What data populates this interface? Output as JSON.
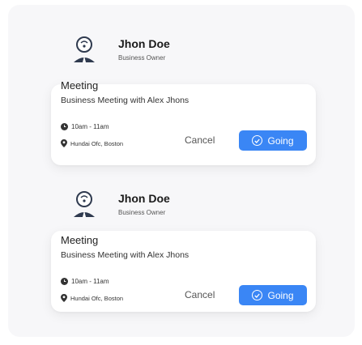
{
  "events": [
    {
      "host": {
        "name": "Jhon Doe",
        "role": "Business Owner"
      },
      "title": "Meeting",
      "description": "Business Meeting with Alex Jhons",
      "time": "10am - 11am",
      "location": "Hundai Ofc, Boston",
      "cancel_label": "Cancel",
      "going_label": "Going"
    },
    {
      "host": {
        "name": "Jhon Doe",
        "role": "Business Owner"
      },
      "title": "Meeting",
      "description": "Business Meeting with Alex Jhons",
      "time": "10am - 11am",
      "location": "Hundai Ofc, Boston",
      "cancel_label": "Cancel",
      "going_label": "Going"
    }
  ],
  "colors": {
    "accent": "#3a86f5",
    "panel": "#f7f7f9",
    "avatar_dark": "#2f3a4f"
  }
}
